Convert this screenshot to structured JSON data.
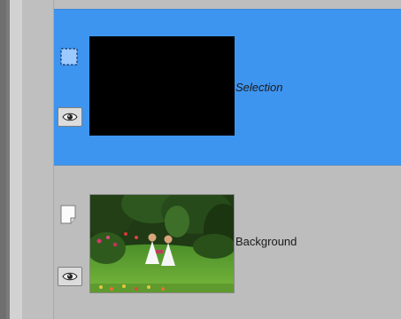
{
  "layers": [
    {
      "name": "Selection",
      "type": "selection",
      "visible": true,
      "selected": true,
      "thumbnail": "black"
    },
    {
      "name": "Background",
      "type": "raster",
      "visible": true,
      "selected": false,
      "thumbnail": "photo-garden-children"
    }
  ],
  "colors": {
    "selected_row": "#3d95f0",
    "panel_bg": "#bdbdbd",
    "icon_blue": "#4aa3ff"
  },
  "icons": {
    "selection_type": "dashed-selection-icon",
    "raster_type": "page-icon",
    "visibility": "eye-icon"
  }
}
